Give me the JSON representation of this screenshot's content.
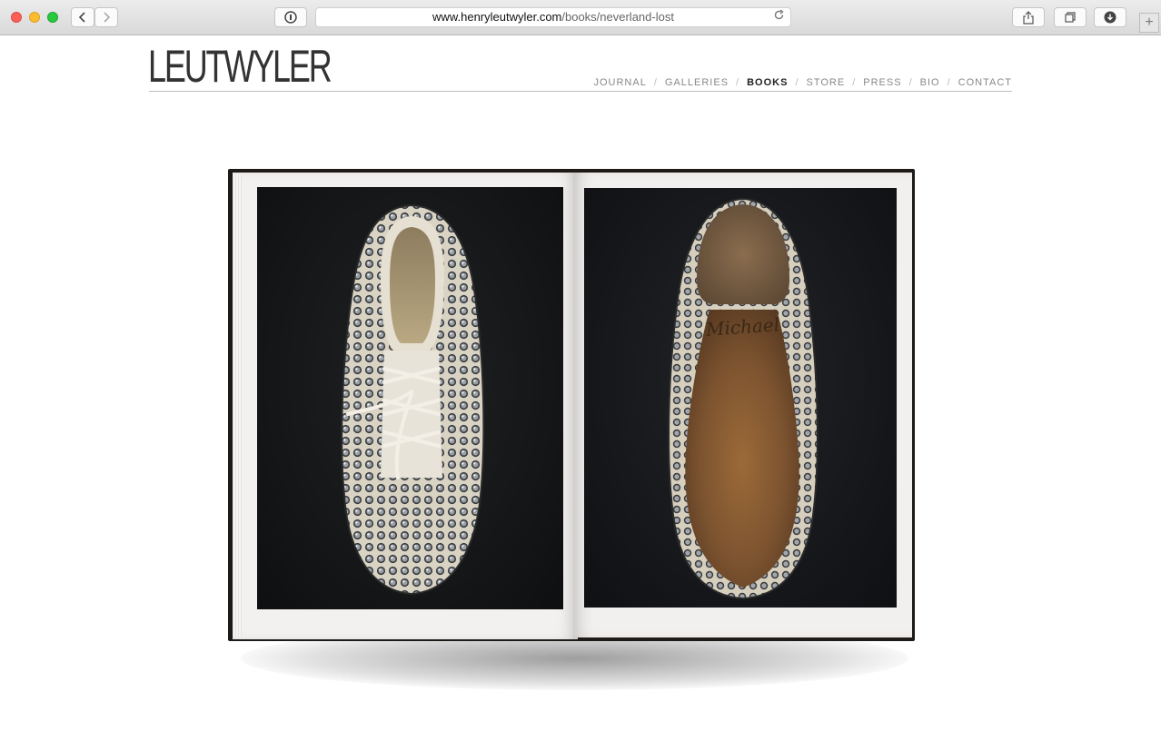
{
  "browser": {
    "url_domain": "www.henryleutwyler.com",
    "url_path": "/books/neverland-lost",
    "back_icon": "chevron-left-icon",
    "forward_icon": "chevron-right-icon",
    "reader_icon": "reader-icon",
    "reload_icon": "reload-icon",
    "share_icon": "share-icon",
    "tabs_icon": "tabs-icon",
    "download_icon": "download-icon",
    "new_tab_icon": "plus-icon"
  },
  "site": {
    "logo": "LEUTWYLER",
    "nav": [
      {
        "label": "JOURNAL"
      },
      {
        "label": "GALLERIES"
      },
      {
        "label": "BOOKS"
      },
      {
        "label": "STORE"
      },
      {
        "label": "PRESS"
      },
      {
        "label": "BIO"
      },
      {
        "label": "CONTACT"
      }
    ],
    "nav_separator": "/",
    "active_nav": "BOOKS"
  },
  "book": {
    "sole_inscription": "Michael"
  },
  "colors": {
    "accent_text": "#222222",
    "nav_text": "#888888",
    "photo_background": "#141516"
  }
}
